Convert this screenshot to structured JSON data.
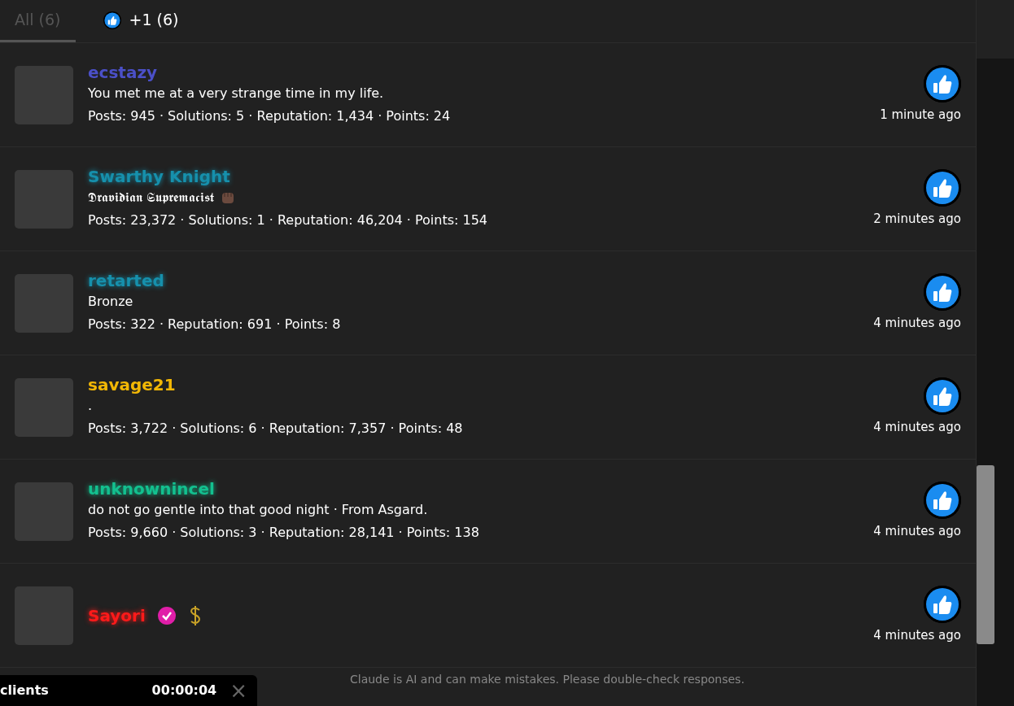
{
  "tabs": [
    {
      "label": "All (6)",
      "selected": true,
      "kind": "text"
    },
    {
      "label": "+1 (6)",
      "selected": false,
      "kind": "like"
    }
  ],
  "users": [
    {
      "name": "ecstazy",
      "color": "#4b50c8",
      "glow": false,
      "bio": "You met me at a very strange time in my life.",
      "stats": "Posts: 945 · Solutions: 5 · Reputation: 1,434 · Points: 24",
      "time": "1 minute ago"
    },
    {
      "name": "Swarthy Knight",
      "color": "#1690ac",
      "glow": true,
      "bio": "𝕯𝖗𝖆𝖛𝖎𝖉𝖎𝖆𝖓 𝕾𝖚𝖕𝖗𝖊𝖒𝖆𝖈𝖎𝖘𝖙",
      "stats": "Posts: 23,372 · Solutions: 1 · Reputation: 46,204 · Points: 154",
      "time": "2 minutes ago",
      "bio_badges": [
        {
          "kind": "fist"
        }
      ]
    },
    {
      "name": "retarted",
      "color": "#1690ac",
      "glow": true,
      "bio": "Bronze",
      "stats": "Posts: 322 · Reputation: 691 · Points: 8",
      "time": "4 minutes ago"
    },
    {
      "name": "savage21",
      "color": "#f2b705",
      "glow": false,
      "bio": ".",
      "stats": "Posts: 3,722 · Solutions: 6 · Reputation: 7,357 · Points: 48",
      "time": "4 minutes ago"
    },
    {
      "name": "unknownincel",
      "color": "#13c08f",
      "glow": true,
      "bio": "do not go gentle into that good night · From Asgard.",
      "stats": "Posts: 9,660 · Solutions: 3 · Reputation: 28,141 · Points: 138",
      "time": "4 minutes ago"
    },
    {
      "name": "Sayori",
      "color": "#ff1a1a",
      "glow": true,
      "time": "4 minutes ago",
      "badges": [
        {
          "kind": "verified"
        },
        {
          "kind": "dollar"
        }
      ]
    }
  ],
  "footer": "Claude is AI and can make mistakes. Please double-check responses.",
  "recorder": {
    "label": "clients",
    "timer": "00:00:04",
    "close": "×"
  }
}
